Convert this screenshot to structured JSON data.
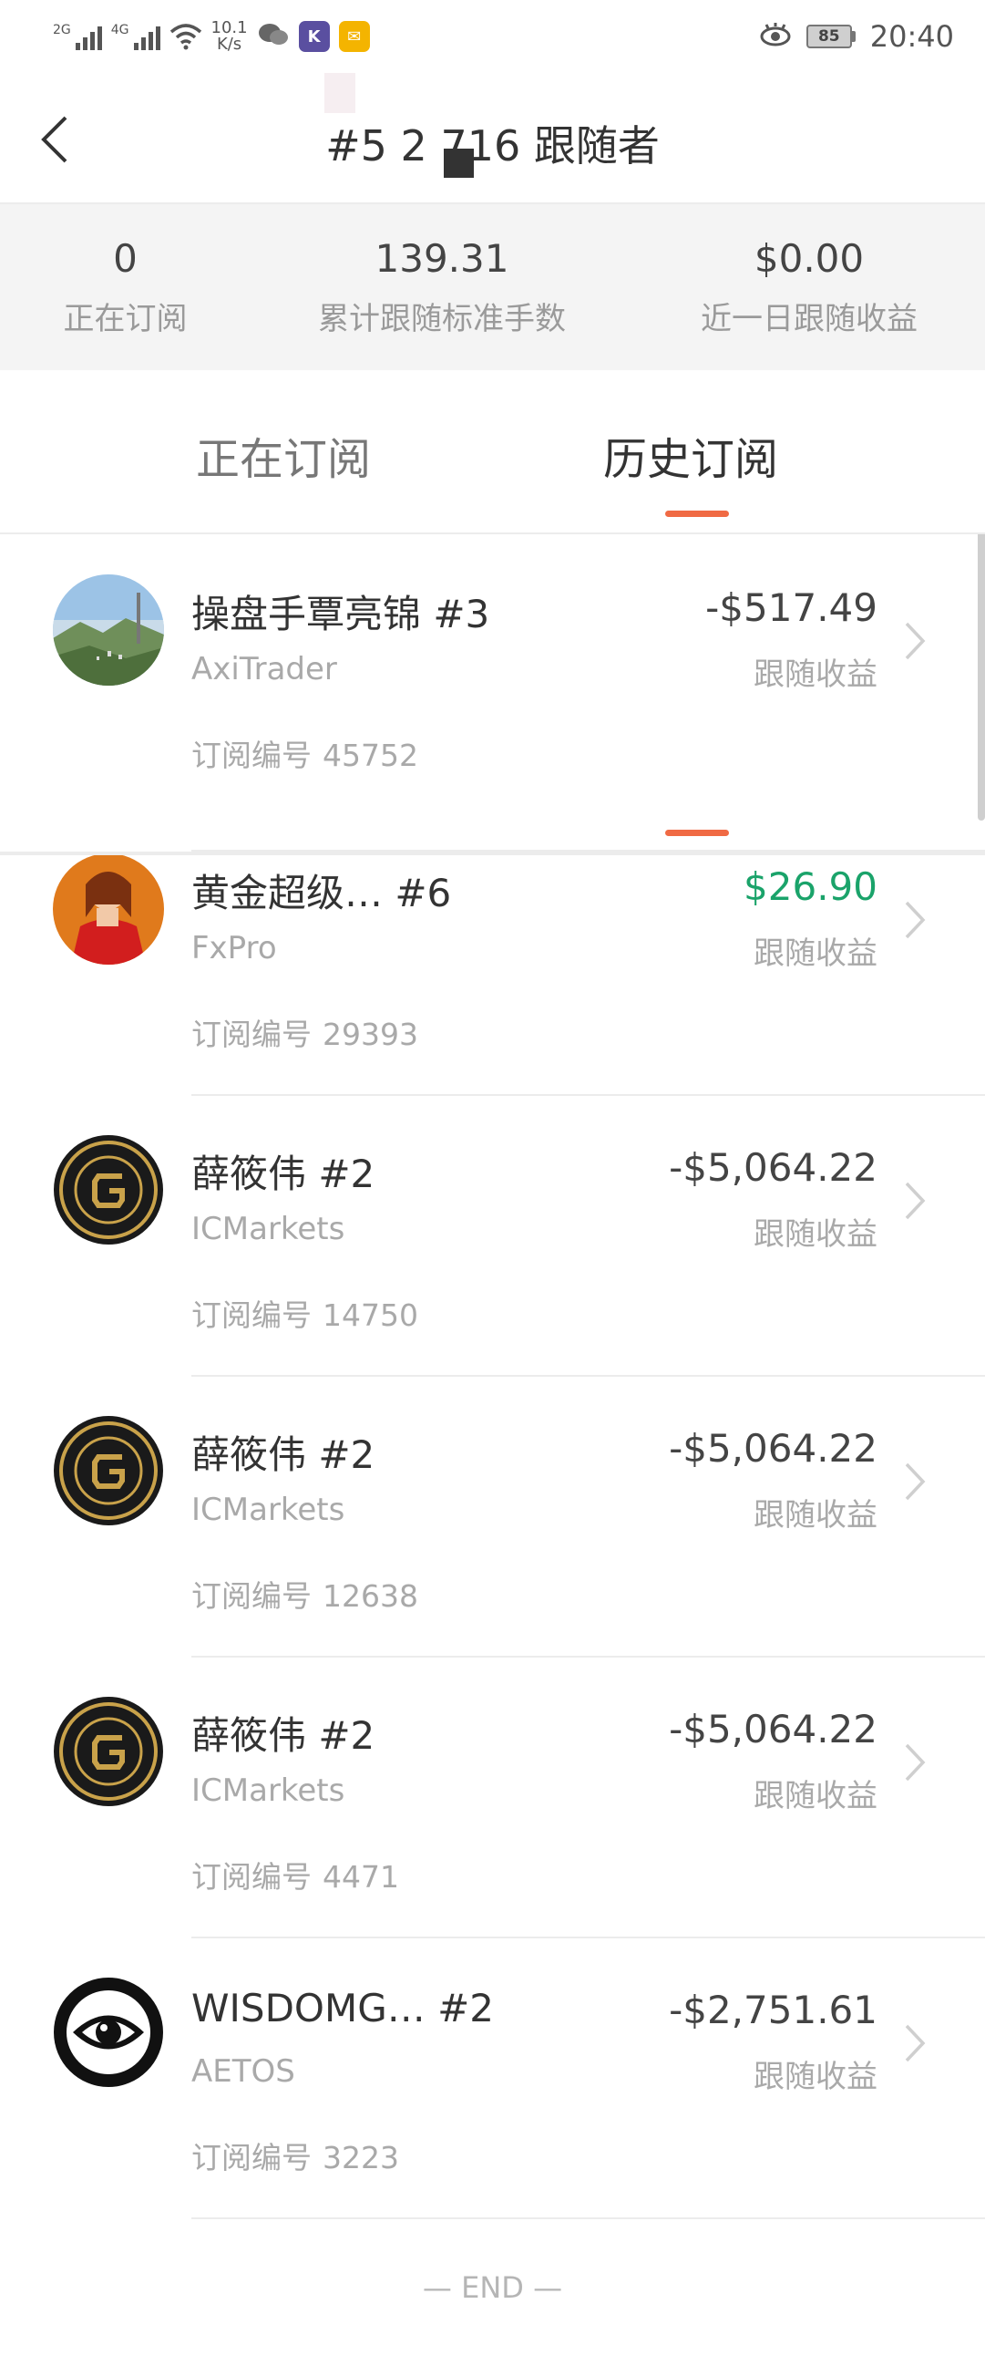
{
  "status_bar": {
    "signal_1_label": "2G",
    "signal_2_label": "4G",
    "net_speed_value": "10.1",
    "net_speed_unit": "K/s",
    "battery": "85",
    "time": "20:40"
  },
  "header": {
    "title": "#5 2        716 跟随者"
  },
  "stats": [
    {
      "value": "0",
      "label": "正在订阅"
    },
    {
      "value": "139.31",
      "label": "累计跟随标准手数"
    },
    {
      "value": "$0.00",
      "label": "近一日跟随收益"
    }
  ],
  "tabs": {
    "current": "正在订阅",
    "history": "历史订阅",
    "active": "history"
  },
  "list_labels": {
    "pnl_label": "跟随收益",
    "sub_id_label": "订阅编号"
  },
  "items": [
    {
      "name": "操盘手覃亮锦 #3",
      "broker": "AxiTrader",
      "pnl": "-$517.49",
      "sub_id": "45752",
      "avatar": "landscape",
      "positive": false
    },
    {
      "name": "黄金超级…   #6",
      "broker": "FxPro",
      "pnl": "$26.90",
      "sub_id": "29393",
      "avatar": "portrait",
      "positive": true
    },
    {
      "name": "薛筱伟 #2",
      "broker": "ICMarkets",
      "pnl": "-$5,064.22",
      "sub_id": "14750",
      "avatar": "gold-logo",
      "positive": false
    },
    {
      "name": "薛筱伟 #2",
      "broker": "ICMarkets",
      "pnl": "-$5,064.22",
      "sub_id": "12638",
      "avatar": "gold-logo",
      "positive": false
    },
    {
      "name": "薛筱伟 #2",
      "broker": "ICMarkets",
      "pnl": "-$5,064.22",
      "sub_id": "4471",
      "avatar": "gold-logo",
      "positive": false
    },
    {
      "name": "WISDOMG…   #2",
      "broker": "AETOS",
      "pnl": "-$2,751.61",
      "sub_id": "3223",
      "avatar": "eye-logo",
      "positive": false
    }
  ],
  "end_text": "— END —",
  "colors": {
    "accent": "#f06a44",
    "positive": "#1aa36a",
    "muted": "#a9a9a9"
  }
}
